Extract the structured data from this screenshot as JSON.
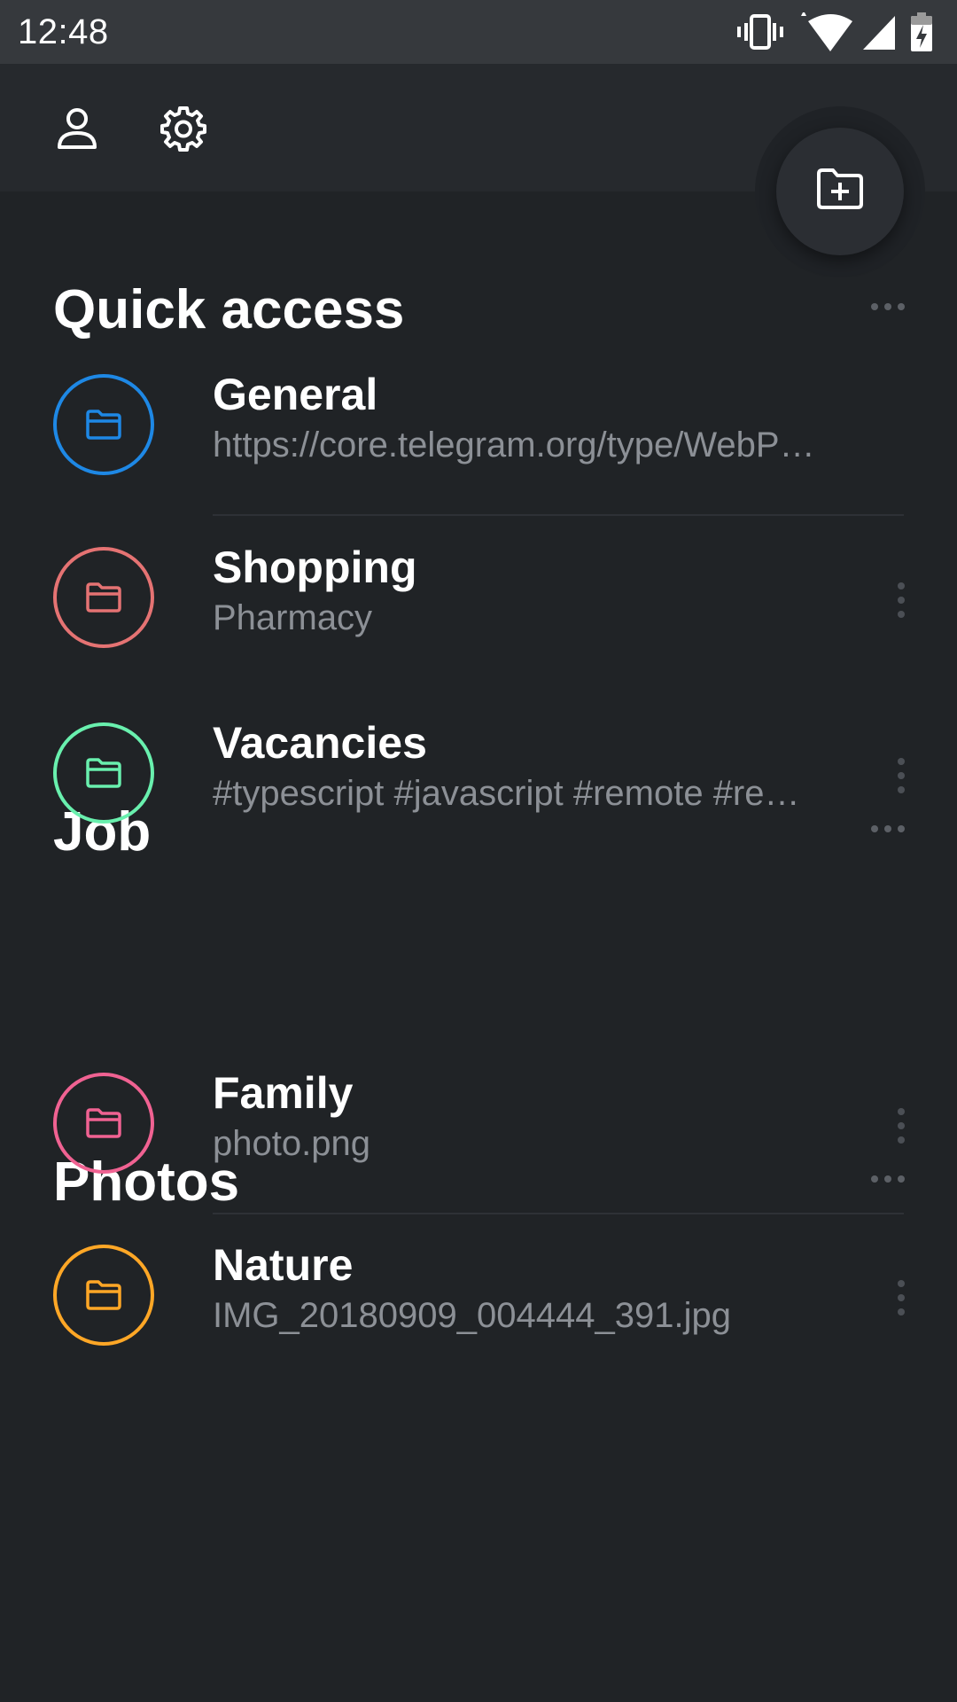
{
  "status_bar": {
    "time": "12:48",
    "icons": [
      "vibrate-icon",
      "wifi-icon",
      "signal-icon",
      "battery-charging-icon"
    ]
  },
  "toolbar": {
    "icons": [
      "profile-icon",
      "settings-icon"
    ],
    "fab_icon": "add-folder-icon"
  },
  "sections": [
    {
      "title": "Quick access",
      "items": [
        {
          "title": "General",
          "subtitle": "https://core.telegram.org/type/WebP…",
          "color": "#1e88e5"
        },
        {
          "title": "Shopping",
          "subtitle": "Pharmacy",
          "color": "#e57373"
        }
      ]
    },
    {
      "title": "Job",
      "items": [
        {
          "title": "Vacancies",
          "subtitle": "#typescript #javascript #remote #re…",
          "color": "#69f0ae"
        }
      ]
    },
    {
      "title": "Photos",
      "items": [
        {
          "title": "Family",
          "subtitle": "photo.png",
          "color": "#f06292"
        },
        {
          "title": "Nature",
          "subtitle": "IMG_20180909_004444_391.jpg",
          "color": "#ffa726"
        }
      ]
    }
  ],
  "colors": {
    "background": "#202326",
    "toolbar": "#26292d",
    "status_bar": "#36393d",
    "subtitle_text": "#8c9096"
  }
}
